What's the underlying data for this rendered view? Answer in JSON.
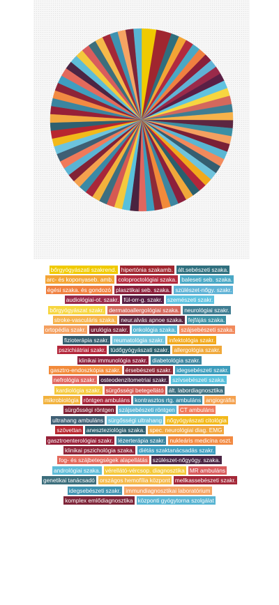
{
  "chart_data": {
    "type": "pie",
    "slices": [
      {
        "label": "bőrgyógyászati szakrend.",
        "value": 2.6,
        "color": "#f0ca00"
      },
      {
        "label": "hipertónia szakamb.",
        "value": 2.7,
        "color": "#a0262f"
      },
      {
        "label": "ált.sebészeti szaka.",
        "value": 1.4,
        "color": "#2f6f7e"
      },
      {
        "label": "arc- és koponyaseb. amb.",
        "value": 1.4,
        "color": "#f3a435"
      },
      {
        "label": "coloproctológiai szaka.",
        "value": 1.4,
        "color": "#b22a3e"
      },
      {
        "label": "baleseti seb. szaka.",
        "value": 1.4,
        "color": "#4aa8c5"
      },
      {
        "label": "égési szaka. és gondozó",
        "value": 1.4,
        "color": "#f08040"
      },
      {
        "label": "plasztikai seb. szaka.",
        "value": 1.4,
        "color": "#8a1f3a"
      },
      {
        "label": "szülészet-nőgy. szakr.",
        "value": 1.4,
        "color": "#60b3d6"
      },
      {
        "label": "audiológiai-ot. szakr.",
        "value": 1.4,
        "color": "#9a2a4a"
      },
      {
        "label": "fül-orr-g. szakr.",
        "value": 1.4,
        "color": "#5a1f45"
      },
      {
        "label": "szemészeti szakr.",
        "value": 1.4,
        "color": "#5fc2e0"
      },
      {
        "label": "bőrgyógyászat szakr.",
        "value": 1.4,
        "color": "#f7d640"
      },
      {
        "label": "dermatoallergológiai szaka.",
        "value": 1.5,
        "color": "#d4685c"
      },
      {
        "label": "neurológiai szakr.",
        "value": 1.4,
        "color": "#3f7d92"
      },
      {
        "label": "stroke-vasculáris szaka.",
        "value": 1.4,
        "color": "#f6b24a"
      },
      {
        "label": "neur.alvás apnoe szaka.",
        "value": 1.4,
        "color": "#5c2741"
      },
      {
        "label": "fejfájás szaka.",
        "value": 1.4,
        "color": "#3b8fa3"
      },
      {
        "label": "ortopédia szakr.",
        "value": 1.4,
        "color": "#f4a060"
      },
      {
        "label": "urulógia szakr.",
        "value": 1.4,
        "color": "#7a2036"
      },
      {
        "label": "onkológia szaka.",
        "value": 1.4,
        "color": "#59b6d3"
      },
      {
        "label": "szájsebészeti szaka.",
        "value": 1.4,
        "color": "#f28a5c"
      },
      {
        "label": "fizioterápia szakr.",
        "value": 1.4,
        "color": "#355e70"
      },
      {
        "label": "reumatológia szakr.",
        "value": 1.4,
        "color": "#6fc3dc"
      },
      {
        "label": "infektológia szakr.",
        "value": 1.4,
        "color": "#f2a91c"
      },
      {
        "label": "pszichiátriai szakr.",
        "value": 1.4,
        "color": "#b3263a"
      },
      {
        "label": "tüdőgyógyászati szakr.",
        "value": 1.4,
        "color": "#2a5f6d"
      },
      {
        "label": "allergológia szakr.",
        "value": 1.4,
        "color": "#f0a83a"
      },
      {
        "label": "klinikai immunológia szakr.",
        "value": 1.5,
        "color": "#8c1f3c"
      },
      {
        "label": "diabetológia szakr.",
        "value": 1.4,
        "color": "#3d86a0"
      },
      {
        "label": "gasztro-endoszkópia szakr.",
        "value": 1.5,
        "color": "#f28a3a"
      },
      {
        "label": "érsebészeti szakr.",
        "value": 1.4,
        "color": "#8e2a38"
      },
      {
        "label": "idegsebészeti szakr.",
        "value": 1.4,
        "color": "#3b9cbc"
      },
      {
        "label": "nefrológia szakr.",
        "value": 1.4,
        "color": "#e0665e"
      },
      {
        "label": "osteodenzitometriai szakr.",
        "value": 1.5,
        "color": "#4a2340"
      },
      {
        "label": "szívsebészeti szaka.",
        "value": 1.4,
        "color": "#58c0dc"
      },
      {
        "label": "kardiológia szakr.",
        "value": 1.4,
        "color": "#f5c93e"
      },
      {
        "label": "sürgősségi betegellátó",
        "value": 1.4,
        "color": "#d65a52"
      },
      {
        "label": "ált. labordiagnosztika",
        "value": 1.4,
        "color": "#3c6f80"
      },
      {
        "label": "mikrobiológia",
        "value": 1.4,
        "color": "#f2b23c"
      },
      {
        "label": "röntgen ambuláns",
        "value": 1.4,
        "color": "#a8263a"
      },
      {
        "label": "kontrasztos rtg. ambuláns",
        "value": 1.4,
        "color": "#3a8aa6"
      },
      {
        "label": "angiográfia",
        "value": 1.4,
        "color": "#f4a14e"
      },
      {
        "label": "sürgősségi röntgen",
        "value": 1.4,
        "color": "#822236"
      },
      {
        "label": "szájsebészeti röntgen",
        "value": 1.4,
        "color": "#5ab4d4"
      },
      {
        "label": "CT ambuláns",
        "value": 1.4,
        "color": "#f07a5a"
      },
      {
        "label": "ultrahang ambuláns",
        "value": 1.4,
        "color": "#3f5f74"
      },
      {
        "label": "sürgősségi ultrahang",
        "value": 1.4,
        "color": "#6cc3de"
      },
      {
        "label": "nőgyógyászati citológia",
        "value": 1.4,
        "color": "#f2b91a"
      },
      {
        "label": "szövettan",
        "value": 1.4,
        "color": "#b8262f"
      },
      {
        "label": "aneszteziológia szaka.",
        "value": 1.4,
        "color": "#2f6070"
      },
      {
        "label": "spec. neurológiai diag. EMG",
        "value": 1.5,
        "color": "#f2a840"
      },
      {
        "label": "gasztroenterológiai szakr.",
        "value": 1.4,
        "color": "#962038"
      },
      {
        "label": "lézerterápia szakr.",
        "value": 1.4,
        "color": "#3a85a0"
      },
      {
        "label": "nukleáris medicina oszt.",
        "value": 1.4,
        "color": "#f28a42"
      },
      {
        "label": "klinikai pszichológia szaka.",
        "value": 1.4,
        "color": "#8e2438"
      },
      {
        "label": "diétás szaktanácsadás szakr.",
        "value": 1.4,
        "color": "#3f9ec0"
      },
      {
        "label": "fog- és szájbetegségek alapellátás",
        "value": 1.5,
        "color": "#e36a5c"
      },
      {
        "label": "szülészet-nőgyógy. szaka.",
        "value": 1.4,
        "color": "#4b2544"
      },
      {
        "label": "andrológiai szaka.",
        "value": 1.4,
        "color": "#5ebcd8"
      },
      {
        "label": "vérellátó-vércsop. diagnosztika",
        "value": 1.4,
        "color": "#f4c93c"
      },
      {
        "label": "MR ambuláns",
        "value": 1.4,
        "color": "#d95c5c"
      },
      {
        "label": "genetikai tanácsadó",
        "value": 1.4,
        "color": "#3c6e7c"
      },
      {
        "label": "országos hemofília központ",
        "value": 1.4,
        "color": "#f5b94a"
      },
      {
        "label": "mellkassebészeti szakr.",
        "value": 1.4,
        "color": "#a42838"
      },
      {
        "label": "idegsebészeti szakr.",
        "value": 1.4,
        "color": "#3e92b0"
      },
      {
        "label": "immundiagnosztikai laboratórium",
        "value": 1.4,
        "color": "#f5a463"
      },
      {
        "label": "komplex emlődiagnosztika",
        "value": 1.4,
        "color": "#7e2438"
      },
      {
        "label": "központi gyógytorna szolgálat",
        "value": 1.4,
        "color": "#58b4d2"
      }
    ]
  }
}
